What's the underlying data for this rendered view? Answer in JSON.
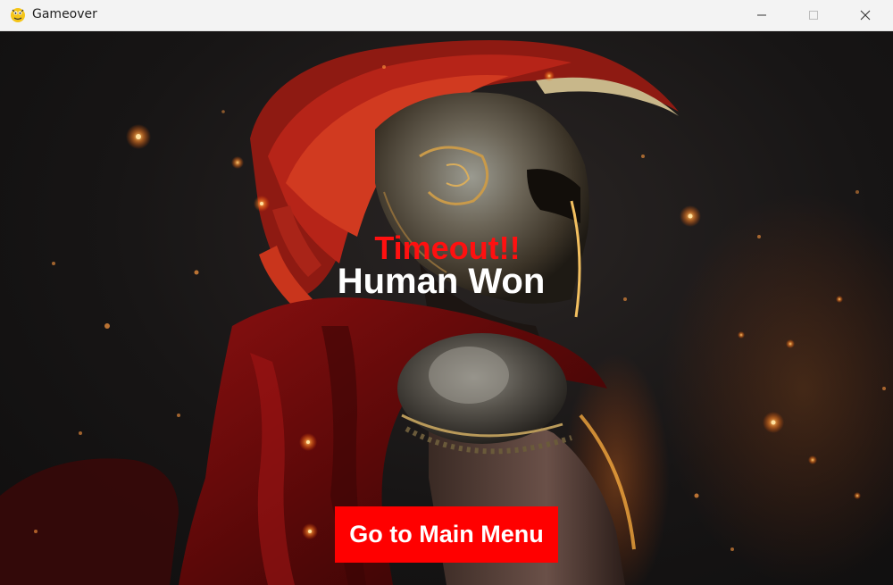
{
  "window": {
    "title": "Gameover",
    "app_icon": "python-snake-icon",
    "controls": [
      "minimize-icon",
      "maximize-icon",
      "close-icon"
    ]
  },
  "game": {
    "status_text": "Timeout!!",
    "result_text": "Human Won",
    "menu_button_label": "Go to Main Menu",
    "background_image": "spartan-warrior-artwork",
    "colors": {
      "status": "#ff1010",
      "result": "#ffffff",
      "button": "#ff0000",
      "button_text": "#ffffff"
    }
  }
}
